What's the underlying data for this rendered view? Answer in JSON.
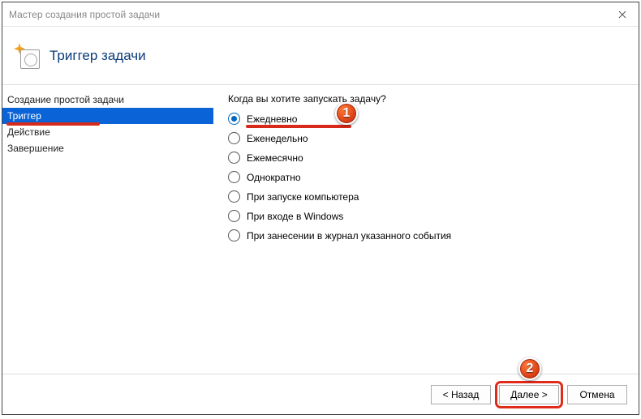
{
  "window": {
    "title": "Мастер создания простой задачи"
  },
  "header": {
    "title": "Триггер задачи"
  },
  "sidebar": {
    "items": [
      {
        "label": "Создание простой задачи"
      },
      {
        "label": "Триггер"
      },
      {
        "label": "Действие"
      },
      {
        "label": "Завершение"
      }
    ]
  },
  "main": {
    "question": "Когда вы хотите запускать задачу?",
    "options": [
      {
        "label": "Ежедневно",
        "checked": true
      },
      {
        "label": "Еженедельно",
        "checked": false
      },
      {
        "label": "Ежемесячно",
        "checked": false
      },
      {
        "label": "Однократно",
        "checked": false
      },
      {
        "label": "При запуске компьютера",
        "checked": false
      },
      {
        "label": "При входе в Windows",
        "checked": false
      },
      {
        "label": "При занесении в журнал указанного события",
        "checked": false
      }
    ]
  },
  "footer": {
    "back": "< Назад",
    "next": "Далее >",
    "cancel": "Отмена"
  },
  "annotations": {
    "callout1": "1",
    "callout2": "2"
  }
}
